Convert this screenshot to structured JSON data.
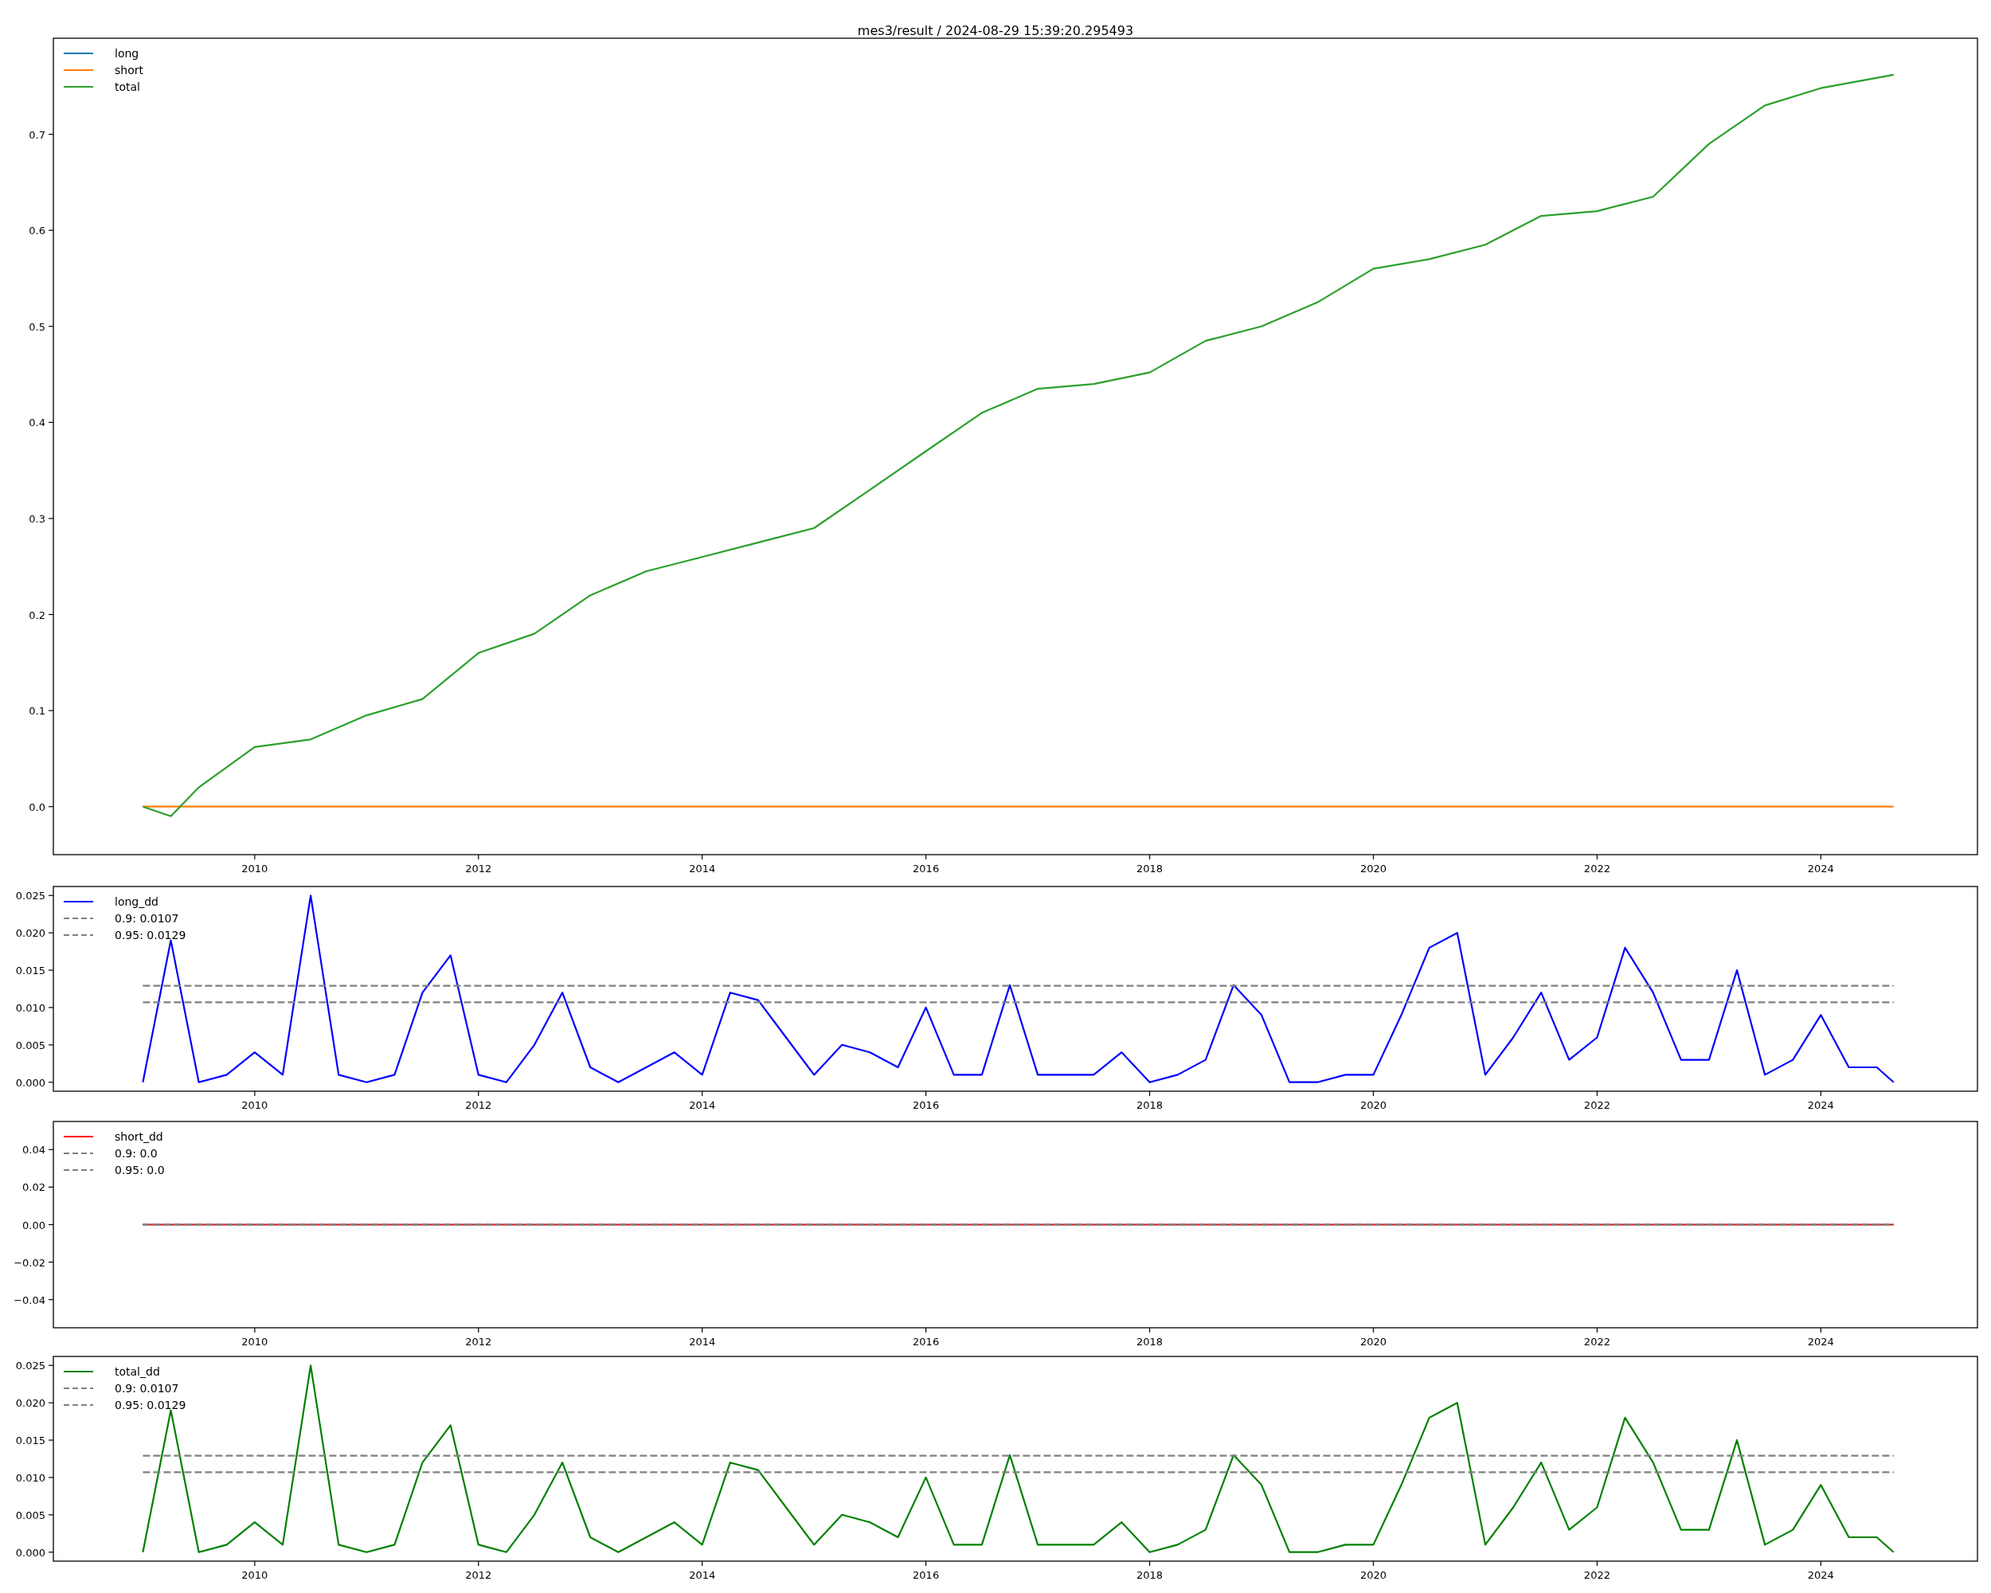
{
  "title": "mes3/result / 2024-08-29 15:39:20.295493",
  "panels": [
    {
      "chart_data": {
        "type": "line",
        "legend": true,
        "x": [
          2009.0,
          2009.25,
          2009.5,
          2010.0,
          2010.5,
          2011.0,
          2011.5,
          2012.0,
          2012.5,
          2013.0,
          2013.5,
          2014.0,
          2014.5,
          2015.0,
          2015.5,
          2016.0,
          2016.5,
          2017.0,
          2017.5,
          2018.0,
          2018.5,
          2019.0,
          2019.5,
          2020.0,
          2020.5,
          2021.0,
          2021.5,
          2022.0,
          2022.5,
          2023.0,
          2023.5,
          2024.0,
          2024.65
        ],
        "xlim": [
          2008.2,
          2025.4
        ],
        "ylim": [
          -0.05,
          0.8
        ],
        "xticks": [
          {
            "value": 2010,
            "label": "2010"
          },
          {
            "value": 2012,
            "label": "2012"
          },
          {
            "value": 2014,
            "label": "2014"
          },
          {
            "value": 2016,
            "label": "2016"
          },
          {
            "value": 2018,
            "label": "2018"
          },
          {
            "value": 2020,
            "label": "2020"
          },
          {
            "value": 2022,
            "label": "2022"
          },
          {
            "value": 2024,
            "label": "2024"
          }
        ],
        "yticks": [
          {
            "value": 0,
            "label": "0.0"
          },
          {
            "value": 0.1,
            "label": "0.1"
          },
          {
            "value": 0.2,
            "label": "0.2"
          },
          {
            "value": 0.3,
            "label": "0.3"
          },
          {
            "value": 0.4,
            "label": "0.4"
          },
          {
            "value": 0.5,
            "label": "0.5"
          },
          {
            "value": 0.6,
            "label": "0.6"
          },
          {
            "value": 0.7,
            "label": "0.7"
          }
        ],
        "series": [
          {
            "name": "long",
            "color": "#1f77b4",
            "line_style": "solid",
            "values": [
              null,
              null,
              null,
              null,
              null,
              null,
              null,
              null,
              null,
              null,
              null,
              null,
              null,
              null,
              null,
              null,
              null,
              null,
              null,
              null,
              null,
              null,
              null,
              null,
              null,
              null,
              null,
              null,
              null,
              null,
              null,
              null,
              null
            ]
          },
          {
            "name": "short",
            "color": "#ff7f0e",
            "line_style": "solid",
            "values": [
              0,
              0,
              0,
              0,
              0,
              0,
              0,
              0,
              0,
              0,
              0,
              0,
              0,
              0,
              0,
              0,
              0,
              0,
              0,
              0,
              0,
              0,
              0,
              0,
              0,
              0,
              0,
              0,
              0,
              0,
              0,
              0,
              0
            ]
          },
          {
            "name": "total",
            "color": "#2ca02c",
            "line_style": "solid",
            "values": [
              0.0,
              -0.01,
              0.02,
              0.062,
              0.07,
              0.095,
              0.112,
              0.16,
              0.18,
              0.22,
              0.245,
              0.26,
              0.275,
              0.29,
              0.33,
              0.37,
              0.41,
              0.435,
              0.44,
              0.452,
              0.485,
              0.5,
              0.525,
              0.56,
              0.57,
              0.585,
              0.615,
              0.62,
              0.635,
              0.69,
              0.73,
              0.748,
              0.762
            ]
          }
        ]
      }
    },
    {
      "chart_data": {
        "type": "line",
        "legend": true,
        "x": [
          2009.0,
          2009.25,
          2009.5,
          2009.75,
          2010.0,
          2010.25,
          2010.5,
          2010.75,
          2011.0,
          2011.25,
          2011.5,
          2011.75,
          2012.0,
          2012.25,
          2012.5,
          2012.75,
          2013.0,
          2013.25,
          2013.5,
          2013.75,
          2014.0,
          2014.25,
          2014.5,
          2014.75,
          2015.0,
          2015.25,
          2015.5,
          2015.75,
          2016.0,
          2016.25,
          2016.5,
          2016.75,
          2017.0,
          2017.25,
          2017.5,
          2017.75,
          2018.0,
          2018.25,
          2018.5,
          2018.75,
          2019.0,
          2019.25,
          2019.5,
          2019.75,
          2020.0,
          2020.25,
          2020.5,
          2020.75,
          2021.0,
          2021.25,
          2021.5,
          2021.75,
          2022.0,
          2022.25,
          2022.5,
          2022.75,
          2023.0,
          2023.25,
          2023.5,
          2023.75,
          2024.0,
          2024.25,
          2024.5,
          2024.65
        ],
        "xlim": [
          2008.2,
          2025.4
        ],
        "ylim": [
          -0.0012,
          0.0262
        ],
        "xticks": [
          {
            "value": 2010,
            "label": "2010"
          },
          {
            "value": 2012,
            "label": "2012"
          },
          {
            "value": 2014,
            "label": "2014"
          },
          {
            "value": 2016,
            "label": "2016"
          },
          {
            "value": 2018,
            "label": "2018"
          },
          {
            "value": 2020,
            "label": "2020"
          },
          {
            "value": 2022,
            "label": "2022"
          },
          {
            "value": 2024,
            "label": "2024"
          }
        ],
        "yticks": [
          {
            "value": 0,
            "label": "0.000"
          },
          {
            "value": 0.005,
            "label": "0.005"
          },
          {
            "value": 0.01,
            "label": "0.010"
          },
          {
            "value": 0.015,
            "label": "0.015"
          },
          {
            "value": 0.02,
            "label": "0.020"
          },
          {
            "value": 0.025,
            "label": "0.025"
          }
        ],
        "series": [
          {
            "name": "long_dd",
            "color": "#0000ff",
            "line_style": "solid",
            "values": [
              0,
              0.019,
              0,
              0.001,
              0.004,
              0.001,
              0.025,
              0.001,
              0,
              0.001,
              0.012,
              0.017,
              0.001,
              0,
              0.005,
              0.012,
              0.002,
              0,
              0.002,
              0.004,
              0.001,
              0.012,
              0.011,
              0.006,
              0.001,
              0.005,
              0.004,
              0.002,
              0.01,
              0.001,
              0.001,
              0.013,
              0.001,
              0.001,
              0.001,
              0.004,
              0,
              0.001,
              0.003,
              0.013,
              0.009,
              0,
              0,
              0.001,
              0.001,
              0.009,
              0.018,
              0.02,
              0.001,
              0.006,
              0.012,
              0.003,
              0.006,
              0.018,
              0.012,
              0.003,
              0.003,
              0.015,
              0.001,
              0.003,
              0.009,
              0.002,
              0.002,
              0
            ]
          },
          {
            "name": "0.9: 0.0107",
            "color": "#808080",
            "line_style": "dashed",
            "values": [
              0.0107,
              0.0107,
              0.0107,
              0.0107,
              0.0107,
              0.0107,
              0.0107,
              0.0107,
              0.0107,
              0.0107,
              0.0107,
              0.0107,
              0.0107,
              0.0107,
              0.0107,
              0.0107,
              0.0107,
              0.0107,
              0.0107,
              0.0107,
              0.0107,
              0.0107,
              0.0107,
              0.0107,
              0.0107,
              0.0107,
              0.0107,
              0.0107,
              0.0107,
              0.0107,
              0.0107,
              0.0107,
              0.0107,
              0.0107,
              0.0107,
              0.0107,
              0.0107,
              0.0107,
              0.0107,
              0.0107,
              0.0107,
              0.0107,
              0.0107,
              0.0107,
              0.0107,
              0.0107,
              0.0107,
              0.0107,
              0.0107,
              0.0107,
              0.0107,
              0.0107,
              0.0107,
              0.0107,
              0.0107,
              0.0107,
              0.0107,
              0.0107,
              0.0107,
              0.0107,
              0.0107,
              0.0107,
              0.0107,
              0.0107
            ]
          },
          {
            "name": "0.95: 0.0129",
            "color": "#808080",
            "line_style": "dashed",
            "values": [
              0.0129,
              0.0129,
              0.0129,
              0.0129,
              0.0129,
              0.0129,
              0.0129,
              0.0129,
              0.0129,
              0.0129,
              0.0129,
              0.0129,
              0.0129,
              0.0129,
              0.0129,
              0.0129,
              0.0129,
              0.0129,
              0.0129,
              0.0129,
              0.0129,
              0.0129,
              0.0129,
              0.0129,
              0.0129,
              0.0129,
              0.0129,
              0.0129,
              0.0129,
              0.0129,
              0.0129,
              0.0129,
              0.0129,
              0.0129,
              0.0129,
              0.0129,
              0.0129,
              0.0129,
              0.0129,
              0.0129,
              0.0129,
              0.0129,
              0.0129,
              0.0129,
              0.0129,
              0.0129,
              0.0129,
              0.0129,
              0.0129,
              0.0129,
              0.0129,
              0.0129,
              0.0129,
              0.0129,
              0.0129,
              0.0129,
              0.0129,
              0.0129,
              0.0129,
              0.0129,
              0.0129,
              0.0129,
              0.0129,
              0.0129
            ]
          }
        ]
      }
    },
    {
      "chart_data": {
        "type": "line",
        "legend": true,
        "x": [
          2009.0,
          2024.65
        ],
        "xlim": [
          2008.2,
          2025.4
        ],
        "ylim": [
          -0.055,
          0.055
        ],
        "xticks": [
          {
            "value": 2010,
            "label": "2010"
          },
          {
            "value": 2012,
            "label": "2012"
          },
          {
            "value": 2014,
            "label": "2014"
          },
          {
            "value": 2016,
            "label": "2016"
          },
          {
            "value": 2018,
            "label": "2018"
          },
          {
            "value": 2020,
            "label": "2020"
          },
          {
            "value": 2022,
            "label": "2022"
          },
          {
            "value": 2024,
            "label": "2024"
          }
        ],
        "yticks": [
          {
            "value": -0.04,
            "label": "−0.04"
          },
          {
            "value": -0.02,
            "label": "−0.02"
          },
          {
            "value": 0,
            "label": "0.00"
          },
          {
            "value": 0.02,
            "label": "0.02"
          },
          {
            "value": 0.04,
            "label": "0.04"
          }
        ],
        "series": [
          {
            "name": "short_dd",
            "color": "#ff0000",
            "line_style": "solid",
            "values": [
              0,
              0
            ]
          },
          {
            "name": "0.9: 0.0",
            "color": "#808080",
            "line_style": "dashed",
            "values": [
              0,
              0
            ]
          },
          {
            "name": "0.95: 0.0",
            "color": "#808080",
            "line_style": "dashed",
            "values": [
              0,
              0
            ]
          }
        ]
      }
    },
    {
      "chart_data": {
        "type": "line",
        "legend": true,
        "x": [
          2009.0,
          2009.25,
          2009.5,
          2009.75,
          2010.0,
          2010.25,
          2010.5,
          2010.75,
          2011.0,
          2011.25,
          2011.5,
          2011.75,
          2012.0,
          2012.25,
          2012.5,
          2012.75,
          2013.0,
          2013.25,
          2013.5,
          2013.75,
          2014.0,
          2014.25,
          2014.5,
          2014.75,
          2015.0,
          2015.25,
          2015.5,
          2015.75,
          2016.0,
          2016.25,
          2016.5,
          2016.75,
          2017.0,
          2017.25,
          2017.5,
          2017.75,
          2018.0,
          2018.25,
          2018.5,
          2018.75,
          2019.0,
          2019.25,
          2019.5,
          2019.75,
          2020.0,
          2020.25,
          2020.5,
          2020.75,
          2021.0,
          2021.25,
          2021.5,
          2021.75,
          2022.0,
          2022.25,
          2022.5,
          2022.75,
          2023.0,
          2023.25,
          2023.5,
          2023.75,
          2024.0,
          2024.25,
          2024.5,
          2024.65
        ],
        "xlim": [
          2008.2,
          2025.4
        ],
        "ylim": [
          -0.0012,
          0.0262
        ],
        "xticks": [
          {
            "value": 2010,
            "label": "2010"
          },
          {
            "value": 2012,
            "label": "2012"
          },
          {
            "value": 2014,
            "label": "2014"
          },
          {
            "value": 2016,
            "label": "2016"
          },
          {
            "value": 2018,
            "label": "2018"
          },
          {
            "value": 2020,
            "label": "2020"
          },
          {
            "value": 2022,
            "label": "2022"
          },
          {
            "value": 2024,
            "label": "2024"
          }
        ],
        "yticks": [
          {
            "value": 0,
            "label": "0.000"
          },
          {
            "value": 0.005,
            "label": "0.005"
          },
          {
            "value": 0.01,
            "label": "0.010"
          },
          {
            "value": 0.015,
            "label": "0.015"
          },
          {
            "value": 0.02,
            "label": "0.020"
          },
          {
            "value": 0.025,
            "label": "0.025"
          }
        ],
        "series": [
          {
            "name": "total_dd",
            "color": "#008000",
            "line_style": "solid",
            "values": [
              0,
              0.019,
              0,
              0.001,
              0.004,
              0.001,
              0.025,
              0.001,
              0,
              0.001,
              0.012,
              0.017,
              0.001,
              0,
              0.005,
              0.012,
              0.002,
              0,
              0.002,
              0.004,
              0.001,
              0.012,
              0.011,
              0.006,
              0.001,
              0.005,
              0.004,
              0.002,
              0.01,
              0.001,
              0.001,
              0.013,
              0.001,
              0.001,
              0.001,
              0.004,
              0,
              0.001,
              0.003,
              0.013,
              0.009,
              0,
              0,
              0.001,
              0.001,
              0.009,
              0.018,
              0.02,
              0.001,
              0.006,
              0.012,
              0.003,
              0.006,
              0.018,
              0.012,
              0.003,
              0.003,
              0.015,
              0.001,
              0.003,
              0.009,
              0.002,
              0.002,
              0
            ]
          },
          {
            "name": "0.9: 0.0107",
            "color": "#808080",
            "line_style": "dashed",
            "values": [
              0.0107,
              0.0107,
              0.0107,
              0.0107,
              0.0107,
              0.0107,
              0.0107,
              0.0107,
              0.0107,
              0.0107,
              0.0107,
              0.0107,
              0.0107,
              0.0107,
              0.0107,
              0.0107,
              0.0107,
              0.0107,
              0.0107,
              0.0107,
              0.0107,
              0.0107,
              0.0107,
              0.0107,
              0.0107,
              0.0107,
              0.0107,
              0.0107,
              0.0107,
              0.0107,
              0.0107,
              0.0107,
              0.0107,
              0.0107,
              0.0107,
              0.0107,
              0.0107,
              0.0107,
              0.0107,
              0.0107,
              0.0107,
              0.0107,
              0.0107,
              0.0107,
              0.0107,
              0.0107,
              0.0107,
              0.0107,
              0.0107,
              0.0107,
              0.0107,
              0.0107,
              0.0107,
              0.0107,
              0.0107,
              0.0107,
              0.0107,
              0.0107,
              0.0107,
              0.0107,
              0.0107,
              0.0107,
              0.0107,
              0.0107
            ]
          },
          {
            "name": "0.95: 0.0129",
            "color": "#808080",
            "line_style": "dashed",
            "values": [
              0.0129,
              0.0129,
              0.0129,
              0.0129,
              0.0129,
              0.0129,
              0.0129,
              0.0129,
              0.0129,
              0.0129,
              0.0129,
              0.0129,
              0.0129,
              0.0129,
              0.0129,
              0.0129,
              0.0129,
              0.0129,
              0.0129,
              0.0129,
              0.0129,
              0.0129,
              0.0129,
              0.0129,
              0.0129,
              0.0129,
              0.0129,
              0.0129,
              0.0129,
              0.0129,
              0.0129,
              0.0129,
              0.0129,
              0.0129,
              0.0129,
              0.0129,
              0.0129,
              0.0129,
              0.0129,
              0.0129,
              0.0129,
              0.0129,
              0.0129,
              0.0129,
              0.0129,
              0.0129,
              0.0129,
              0.0129,
              0.0129,
              0.0129,
              0.0129,
              0.0129,
              0.0129,
              0.0129,
              0.0129,
              0.0129,
              0.0129,
              0.0129,
              0.0129,
              0.0129,
              0.0129,
              0.0129,
              0.0129,
              0.0129
            ]
          }
        ]
      }
    }
  ]
}
